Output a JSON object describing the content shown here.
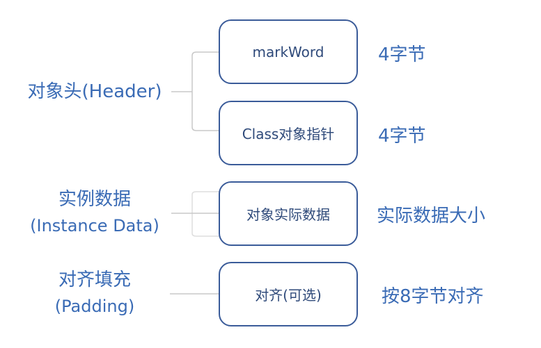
{
  "groups": [
    {
      "title": "对象头(Header)",
      "subtitle": "",
      "items": [
        {
          "label": "markWord",
          "size": "4字节"
        },
        {
          "label": "Class对象指针",
          "size": "4字节"
        }
      ]
    },
    {
      "title": "实例数据",
      "subtitle": "(Instance Data)",
      "items": [
        {
          "label": "对象实际数据",
          "size": "实际数据大小"
        }
      ]
    },
    {
      "title": "对齐填充",
      "subtitle": "(Padding)",
      "items": [
        {
          "label": "对齐(可选)",
          "size": "按8字节对齐"
        }
      ]
    }
  ],
  "colors": {
    "text": "#3a6bb5",
    "box_border": "#3a5b99",
    "connector": "#c8c8c8"
  }
}
